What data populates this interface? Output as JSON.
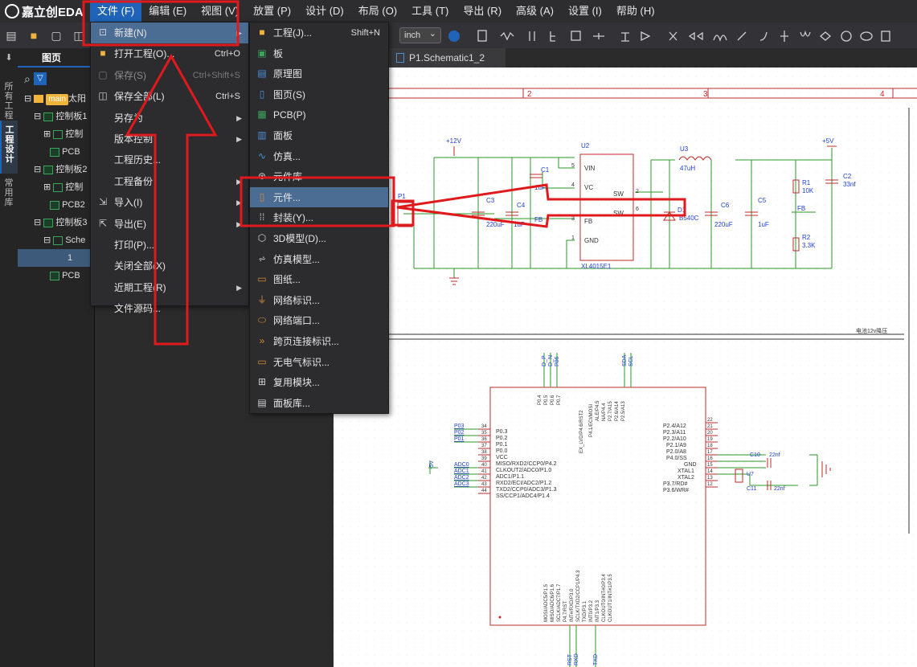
{
  "app": {
    "logo": "嘉立创EDA"
  },
  "menubar": {
    "items": [
      "文件 (F)",
      "编辑 (E)",
      "视图 (V)",
      "放置 (P)",
      "设计 (D)",
      "布局 (O)",
      "工具 (T)",
      "导出 (R)",
      "高级 (A)",
      "设置 (I)",
      "帮助 (H)"
    ]
  },
  "toolbar": {
    "unit": "inch"
  },
  "vtabs": {
    "all_projects": "所有工程",
    "project_design": "工程设计",
    "common_lib": "常用库"
  },
  "panel": {
    "tab": "图页",
    "tree": [
      {
        "text": "太阳",
        "badge": "main"
      },
      {
        "text": "控制板1"
      },
      {
        "text": "控制"
      },
      {
        "text": "PCB"
      },
      {
        "text": "控制板2"
      },
      {
        "text": "控制"
      },
      {
        "text": "PCB2"
      },
      {
        "text": "控制板3"
      },
      {
        "text": "Sche"
      },
      {
        "text": "1"
      },
      {
        "text": "PCB"
      }
    ]
  },
  "file_menu": [
    {
      "label": "新建(N)",
      "submenu": true
    },
    {
      "label": "打开工程(O)...",
      "shortcut": "Ctrl+O"
    },
    {
      "label": "保存(S)",
      "shortcut": "Ctrl+Shift+S",
      "disabled": true
    },
    {
      "label": "保存全部(L)",
      "shortcut": "Ctrl+S"
    },
    {
      "label": "另存为",
      "submenu": true
    },
    {
      "label": "版本控制",
      "submenu": true
    },
    {
      "label": "工程历史..."
    },
    {
      "label": "工程备份",
      "submenu": true
    },
    {
      "label": "导入(I)",
      "submenu": true
    },
    {
      "label": "导出(E)",
      "submenu": true
    },
    {
      "label": "打印(P)..."
    },
    {
      "label": "关闭全部(X)"
    },
    {
      "label": "近期工程(R)",
      "submenu": true
    },
    {
      "label": "文件源码..."
    }
  ],
  "new_submenu": [
    {
      "label": "工程(J)...",
      "shortcut": "Shift+N"
    },
    {
      "label": "板"
    },
    {
      "label": "原理图"
    },
    {
      "label": "图页(S)"
    },
    {
      "label": "PCB(P)"
    },
    {
      "label": "面板"
    },
    {
      "label": "仿真..."
    },
    {
      "label": "元件库"
    },
    {
      "label": "元件..."
    },
    {
      "label": "封装(Y)..."
    },
    {
      "label": "3D模型(D)..."
    },
    {
      "label": "仿真模型..."
    },
    {
      "label": "图纸..."
    },
    {
      "label": "网络标识..."
    },
    {
      "label": "网络端口..."
    },
    {
      "label": "跨页连接标识..."
    },
    {
      "label": "无电气标识..."
    },
    {
      "label": "复用模块..."
    },
    {
      "label": "面板库..."
    }
  ],
  "file_tab": {
    "label": "P1.Schematic1_2"
  },
  "schematic": {
    "column_labels": [
      "2",
      "3",
      "4"
    ],
    "power": {
      "in": "+12V",
      "out": "+5V",
      "gnd_label": "-5V"
    },
    "u2": {
      "ref": "U2",
      "part": "XL4015E1",
      "pins": [
        "VIN",
        "VC",
        "SW",
        "SW",
        "FB",
        "GND"
      ],
      "pin_nums": [
        "5",
        "4",
        "2",
        "3",
        "6",
        "1"
      ]
    },
    "u3": {
      "ref": "U3",
      "value": "47uH"
    },
    "d1": {
      "ref": "D1",
      "value": "B540C"
    },
    "parts": [
      {
        "ref": "C1",
        "value": "1uF"
      },
      {
        "ref": "C3",
        "value": "220uF"
      },
      {
        "ref": "C4",
        "value": "1uF"
      },
      {
        "ref": "C5",
        "value": "1uF"
      },
      {
        "ref": "C6",
        "value": "220uF"
      },
      {
        "ref": "R1",
        "value": "10K"
      },
      {
        "ref": "R2",
        "value": "3.3K"
      },
      {
        "ref": "C2",
        "value": "33nf"
      }
    ],
    "p1": "P1",
    "fb": "FB",
    "sheet_caption": "电池12v降压",
    "mcu": {
      "top_pins": [
        "P0.4",
        "P0.5",
        "P0.6",
        "P0.7",
        "EX_LVD/P4.6/RST2",
        "P4.1/ECI/MOSI",
        "ALE/P4.5",
        "NA/P4.4",
        "P2.7/A15",
        "P2.6/A14",
        "P2.5/A13"
      ],
      "top_nets": [
        "D_P",
        "D_N",
        "P06",
        "SDA",
        "SCL"
      ],
      "left_pins": [
        "P0.3",
        "P0.2",
        "P0.1",
        "P0.0",
        "VCC",
        "MISO/RXD2/CCP0/P4.2",
        "CLKOUT2/ADC0/P1.0",
        "ADC1/P1.1",
        "RXD2/ECI/ADC2/P1.2",
        "TXD2/CCP0/ADC3/P1.3",
        "SS/CCP1/ADC4/P1.4"
      ],
      "left_nums": [
        "34",
        "35",
        "36",
        "37",
        "38",
        "39",
        "40",
        "41",
        "42",
        "43",
        "44"
      ],
      "left_nets": [
        "P03",
        "P02",
        "P01",
        "ADC0",
        "ADC1",
        "ADC2",
        "ADC3"
      ],
      "right_pins": [
        "P2.4/A12",
        "P2.3/A11",
        "P2.2/A10",
        "P2.1/A9",
        "P2.0/A8",
        "P4.0/SS",
        "GND",
        "XTAL1",
        "XTAL2",
        "P3.7/RD#",
        "P3.6/WR#"
      ],
      "right_nums": [
        "22",
        "21",
        "20",
        "19",
        "18",
        "17",
        "16",
        "15",
        "14",
        "13",
        "12"
      ],
      "bottom_pins": [
        "MOSI/ADC5/P1.5",
        "MISO/ADC6/P1.6",
        "SCLK/ADC7/P1.7",
        "P4.7/RST",
        "INT#/RXD/P3.0",
        "SCLK/TXD2/CCP1/P4.3",
        "TXD/P3.1",
        "INT0/P3.2",
        "INT1/P3.3",
        "CLKOUT0/INT#0/P3.4",
        "CLKOUT1/INT#1/P3.5"
      ],
      "bottom_nets": [
        "RST",
        "RXD",
        "TXD"
      ]
    },
    "crystal": {
      "ref": "U7",
      "c10": "C10",
      "c10v": "22nf",
      "c11": "C11",
      "c11v": "22nf"
    }
  }
}
